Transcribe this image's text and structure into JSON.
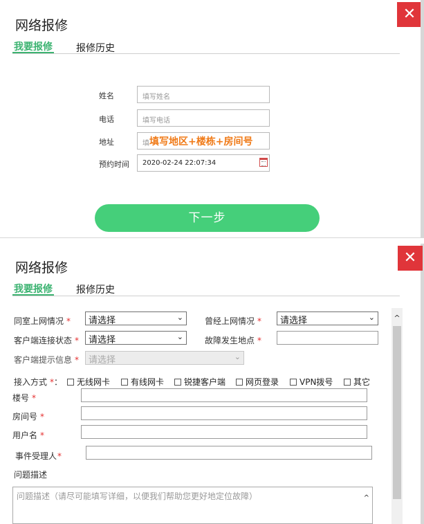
{
  "panel1": {
    "title": "网络报修",
    "tabs": [
      {
        "label": "我要报修"
      },
      {
        "label": "报修历史"
      }
    ],
    "close_glyph": "✕",
    "fields": {
      "name": {
        "label": "姓名",
        "placeholder": "填写姓名"
      },
      "phone": {
        "label": "电话",
        "placeholder": "填写电话"
      },
      "address": {
        "label": "地址",
        "placeholder": "填",
        "overlay": "填写地区+楼栋+房间号"
      },
      "time": {
        "label": "预约时间",
        "value": "2020-02-24 22:07:34"
      }
    },
    "next_label": "下一步"
  },
  "panel2": {
    "title": "网络报修",
    "tabs": [
      {
        "label": "我要报修"
      },
      {
        "label": "报修历史"
      }
    ],
    "close_glyph": "✕",
    "required_mark": "*",
    "fields": {
      "roommate": {
        "label": "同室上网情况",
        "value": "请选择"
      },
      "past": {
        "label": "曾经上网情况",
        "value": "请选择"
      },
      "client_state": {
        "label": "客户端连接状态",
        "value": "请选择"
      },
      "fault_place": {
        "label": "故障发生地点"
      },
      "client_msg": {
        "label": "客户端提示信息",
        "value": "请选择"
      },
      "access": {
        "label": "接入方式",
        "colon": "：",
        "options": [
          "无线网卡",
          "有线网卡",
          "锐捷客户端",
          "网页登录",
          "VPN拨号",
          "其它"
        ]
      },
      "building": {
        "label": "楼号"
      },
      "room": {
        "label": "房间号"
      },
      "username": {
        "label": "用户名"
      },
      "handler": {
        "label": "事件受理人"
      },
      "desc": {
        "label": "问题描述",
        "placeholder": "问题描述（请尽可能填写详细，以便我们帮助您更好地定位故障）"
      }
    },
    "chevron": "⌄",
    "scroll_up": "^"
  },
  "colors": {
    "accent": "#3cb371",
    "close": "#e0353a",
    "button": "#45cf7a",
    "overlay": "#f07a17",
    "required": "#e53030"
  }
}
